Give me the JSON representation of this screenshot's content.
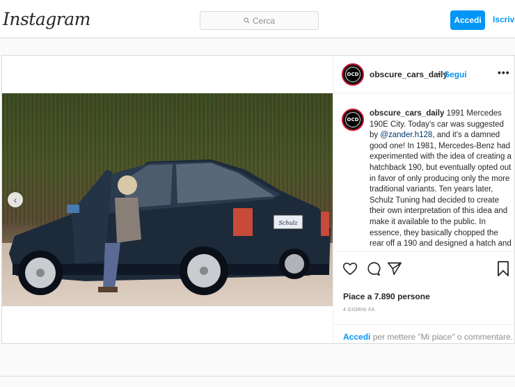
{
  "header": {
    "logo": "Instagram",
    "search_placeholder": "Cerca",
    "login_button": "Accedi",
    "signup_link": "Iscriviti"
  },
  "post": {
    "username": "obscure_cars_daily",
    "dot": "•",
    "follow": "Segui",
    "more": "•••",
    "avatar_text": "OCD",
    "caption_user": "obscure_cars_daily",
    "caption_part1": " 1991 Mercedes 190E City. Today's car was suggested by ",
    "caption_mention": "@zander.h128",
    "caption_part2": ", and it's a damned good one! In 1981, Mercedes-Benz had experimented with the idea of creating a hatchback 190, but eventually opted out in favor of only producing only the more traditional variants. Ten years later, Schulz Tuning had decided to create their own interpretation of this idea and make it available to the public. In essence, they basically chopped the rear off a 190 and designed a hatch and",
    "likes": "Piace a 7.890 persone",
    "date": "4 GIORNI FA",
    "login_prompt_link": "Accedi",
    "login_prompt_text": " per mettere \"Mi piace\" o commentare.",
    "plate_text": "Schulz"
  },
  "colors": {
    "accent": "#0095f6",
    "car": "#1d2a3a"
  },
  "icons": [
    "search-icon",
    "heart-icon",
    "comment-icon",
    "share-icon",
    "bookmark-icon",
    "chevron-left-icon",
    "more-icon"
  ]
}
